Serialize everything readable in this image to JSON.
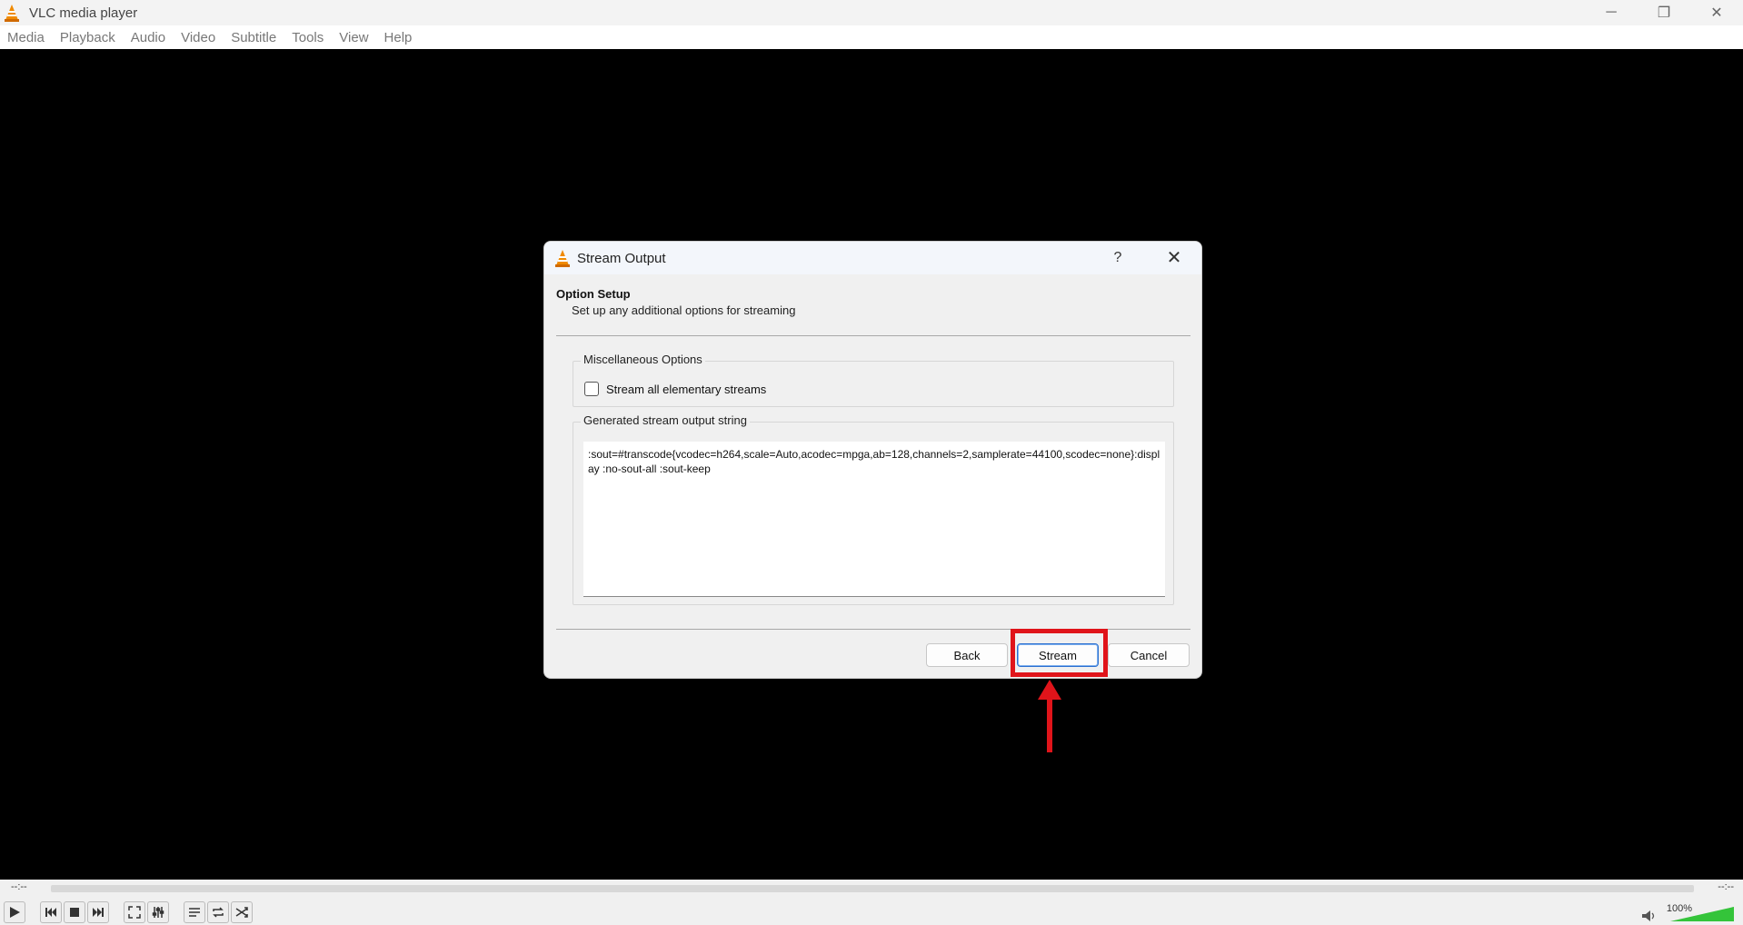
{
  "window": {
    "title": "VLC media player",
    "controls": {
      "minimize": "─",
      "restore": "❐",
      "close": "✕"
    }
  },
  "menu": [
    "Media",
    "Playback",
    "Audio",
    "Video",
    "Subtitle",
    "Tools",
    "View",
    "Help"
  ],
  "dialog": {
    "title": "Stream Output",
    "help": "?",
    "close": "✕",
    "heading": "Option Setup",
    "subheading": "Set up any additional options for streaming",
    "misc_group": {
      "legend": "Miscellaneous Options",
      "checkbox_label": "Stream all elementary streams",
      "checked": false
    },
    "output_group": {
      "legend": "Generated stream output string",
      "value": ":sout=#transcode{vcodec=h264,scale=Auto,acodec=mpga,ab=128,channels=2,samplerate=44100,scodec=none}:display :no-sout-all :sout-keep"
    },
    "buttons": {
      "back": "Back",
      "stream": "Stream",
      "cancel": "Cancel"
    }
  },
  "player": {
    "time_elapsed": "--:--",
    "time_total": "--:--",
    "volume": "100%",
    "volume_level": 1.0
  },
  "colors": {
    "annotation": "#e0141a",
    "vlc_orange": "#f08a00",
    "volume_green": "#34c43a"
  }
}
